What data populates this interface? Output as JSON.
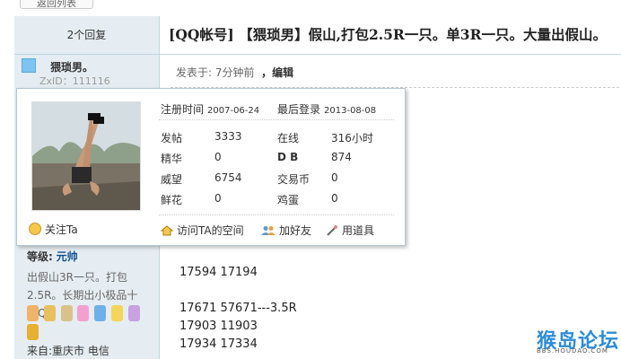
{
  "nav": {
    "back_label": "返回列表"
  },
  "thread": {
    "reply_count": "2个回复",
    "title": "[QQ帐号] 【猥琐男】假山,打包2.5R一只。单3R一只。大量出假山。"
  },
  "user": {
    "name": "猥琐男。",
    "zxid": "ZxID：111116",
    "level_label": "等级:",
    "level_value": "元帅",
    "signature": "出假山3R一只。打包2.5R。长期出小极品十位Q",
    "from": "来自:重庆市 电信"
  },
  "post": {
    "posted_prefix": "发表于: ",
    "posted_time": "7分钟前",
    "edit_label": "，编辑",
    "lines": [
      "17594 17194",
      "",
      "17671 57671---3.5R",
      "17903 11903",
      "17934 17334"
    ]
  },
  "popup": {
    "reg_label": "注册时间",
    "reg_date": "2007-06-24",
    "last_label": "最后登录",
    "last_date": "2013-08-08",
    "stats": [
      {
        "label": "发帖",
        "value": "3333"
      },
      {
        "label": "在线",
        "value": "316小时"
      },
      {
        "label": "精华",
        "value": "0"
      },
      {
        "label": "D B",
        "value": "874"
      },
      {
        "label": "威望",
        "value": "6754"
      },
      {
        "label": "交易币",
        "value": "0"
      },
      {
        "label": "鲜花",
        "value": "0"
      },
      {
        "label": "鸡蛋",
        "value": "0"
      }
    ],
    "follow_label": "关注Ta",
    "actions": {
      "visit": "访问TA的空间",
      "add_friend": "加好友",
      "use_item": "用道具"
    }
  },
  "watermark": {
    "big": "猴岛论坛",
    "small": "BBS.HOUDAO.COM"
  },
  "colors": {
    "panel": "#e5edf2",
    "border": "#c2d5e3",
    "accent": "#2d8dd6"
  }
}
